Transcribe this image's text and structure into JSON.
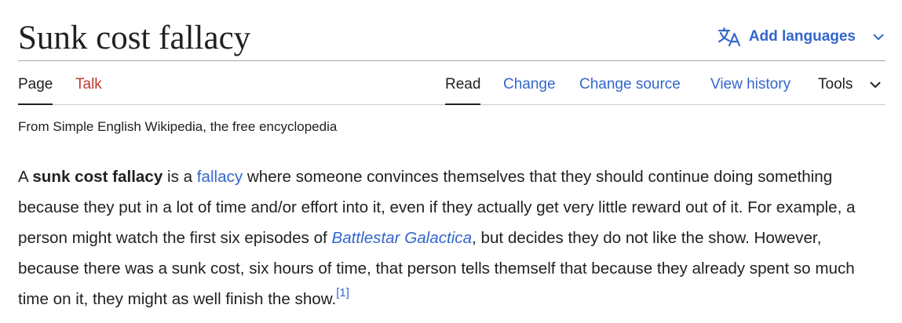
{
  "article": {
    "title": "Sunk cost fallacy",
    "add_languages_label": "Add languages",
    "tagline": "From Simple English Wikipedia, the free encyclopedia"
  },
  "tabs": {
    "left": [
      {
        "label": "Page",
        "state": "selected"
      },
      {
        "label": "Talk",
        "state": "red-link"
      }
    ],
    "right": [
      {
        "label": "Read",
        "state": "selected"
      },
      {
        "label": "Change",
        "state": "link"
      },
      {
        "label": "Change source",
        "state": "link"
      },
      {
        "label": "View history",
        "state": "link"
      },
      {
        "label": "Tools",
        "state": "dropdown"
      }
    ]
  },
  "body": {
    "p1": {
      "t1": "A ",
      "bold_term": "sunk cost fallacy",
      "t2": " is a ",
      "link_fallacy": "fallacy",
      "t3": " where someone convinces themselves that they should continue doing something because they put in a lot of time and/or effort into it, even if they actually get very little reward out of it. For example, a person might watch the first six episodes of ",
      "link_show": "Battlestar Galactica",
      "t4": ", but decides they do not like the show. However, because there was a sunk cost, six hours of time, that person tells themself that because they already spent so much time on it, they might as well finish the show.",
      "ref": "[1]"
    }
  },
  "colors": {
    "link": "#3366cc",
    "text": "#202122",
    "talk_link": "#ba3a2e",
    "divider": "#a2a9b1"
  },
  "icons": {
    "language": "translate-icon",
    "chevron": "chevron-down-icon"
  }
}
